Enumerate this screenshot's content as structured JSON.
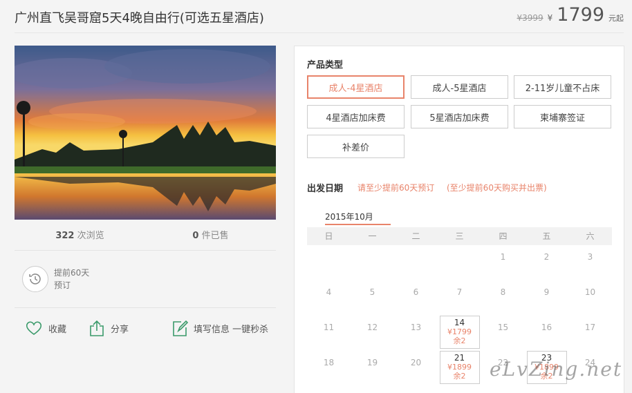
{
  "header": {
    "title": "广州直飞吴哥窟5天4晚自由行(可选五星酒店)",
    "old_price": "¥3999",
    "currency": "¥",
    "price": "1799",
    "unit": "元起"
  },
  "stats": {
    "views_count": "322",
    "views_label": "次浏览",
    "sold_count": "0",
    "sold_label": "件已售"
  },
  "booking": {
    "line1": "提前60天",
    "line2": "预订"
  },
  "actions": {
    "favorite": "收藏",
    "share": "分享",
    "fill_info": "填写信息 一键秒杀"
  },
  "product": {
    "section_label": "产品类型",
    "options": [
      "成人-4星酒店",
      "成人-5星酒店",
      "2-11岁儿童不占床",
      "4星酒店加床费",
      "5星酒店加床费",
      "柬埔寨签证",
      "补差价"
    ],
    "selected_index": 0
  },
  "departure": {
    "section_label": "出发日期",
    "note1": "请至少提前60天预订",
    "note2": "(至少提前60天购买并出票)",
    "month": "2015年10月",
    "weekdays": [
      "日",
      "一",
      "二",
      "三",
      "四",
      "五",
      "六"
    ],
    "days": [
      {
        "d": "1"
      },
      {
        "d": "2"
      },
      {
        "d": "3"
      },
      {
        "d": "4"
      },
      {
        "d": "5"
      },
      {
        "d": "6"
      },
      {
        "d": "7"
      },
      {
        "d": "8"
      },
      {
        "d": "9"
      },
      {
        "d": "10"
      },
      {
        "d": "11"
      },
      {
        "d": "12"
      },
      {
        "d": "13"
      },
      {
        "d": "14",
        "price": "¥1799",
        "stock": "余2"
      },
      {
        "d": "15"
      },
      {
        "d": "16"
      },
      {
        "d": "17"
      },
      {
        "d": "18"
      },
      {
        "d": "19"
      },
      {
        "d": "20"
      },
      {
        "d": "21",
        "price": "¥1899",
        "stock": "余2"
      },
      {
        "d": "22"
      },
      {
        "d": "23",
        "price": "¥1899",
        "stock": "余2"
      },
      {
        "d": "24"
      }
    ]
  },
  "watermark": "eLvZing.net",
  "colors": {
    "accent": "#e8836a",
    "icon_green": "#3a9a6a"
  }
}
